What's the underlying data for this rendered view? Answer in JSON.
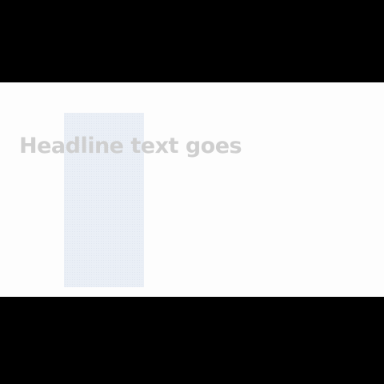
{
  "slide": {
    "headline": "Headline text goes"
  },
  "colors": {
    "letterbox": "#000000",
    "background": "#fdfdfd",
    "panel": "#e9eef6",
    "headline": "#cfcfcf"
  }
}
